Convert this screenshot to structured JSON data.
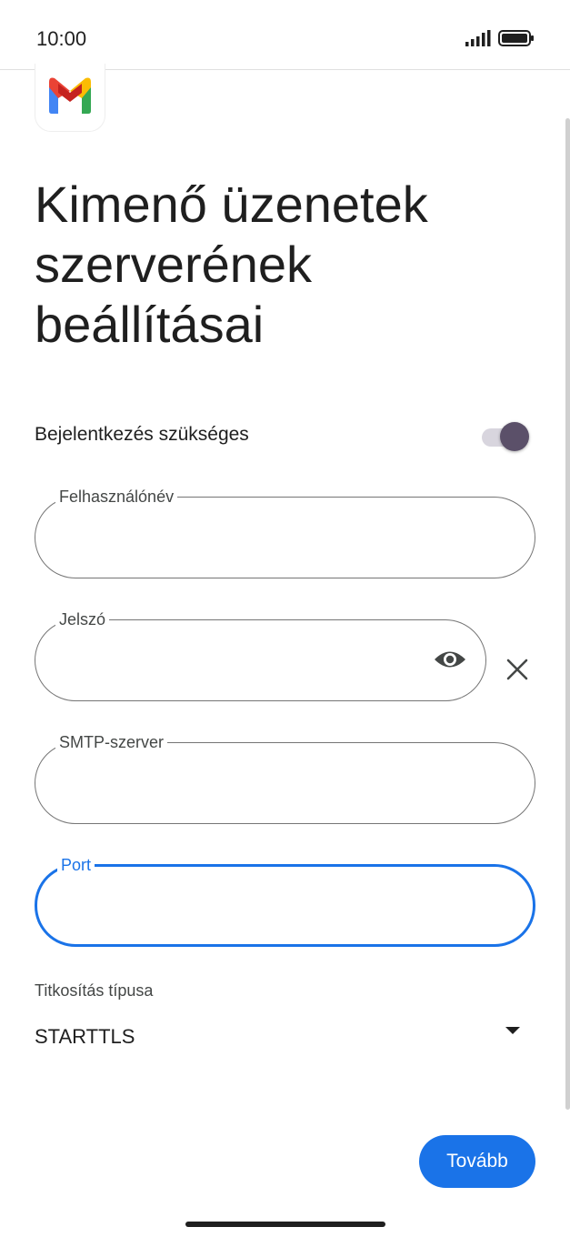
{
  "status_bar": {
    "time": "10:00"
  },
  "app": {
    "logo_icon": "gmail-logo"
  },
  "page": {
    "title": "Kimenő üzenetek szerverének beállításai",
    "login_required_label": "Bejelentkezés szükséges",
    "login_required_on": true
  },
  "fields": {
    "username": {
      "label": "Felhasználónév",
      "value": ""
    },
    "password": {
      "label": "Jelszó",
      "value": ""
    },
    "smtp_server": {
      "label": "SMTP-szerver",
      "value": ""
    },
    "port": {
      "label": "Port",
      "value": ""
    }
  },
  "encryption": {
    "label": "Titkosítás típusa",
    "value": "STARTTLS"
  },
  "next_button": {
    "label": "Tovább"
  },
  "colors": {
    "accent": "#1a73e8",
    "switch_thumb": "#5b5069",
    "switch_track": "#d8d5de"
  }
}
